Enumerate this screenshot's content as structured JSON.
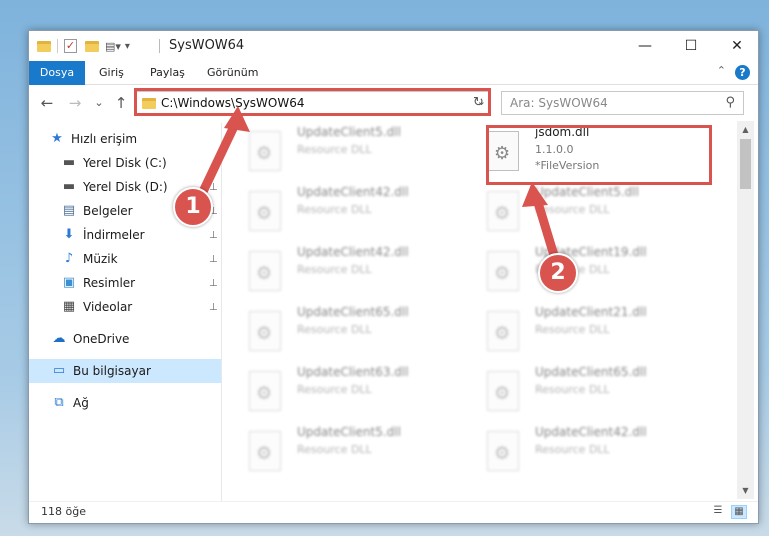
{
  "window": {
    "title": "SysWOW64",
    "minimize_glyph": "—",
    "maximize_glyph": "☐",
    "close_glyph": "✕"
  },
  "ribbon": {
    "tabs": [
      "Dosya",
      "Giriş",
      "Paylaş",
      "Görünüm"
    ],
    "help_glyph": "?",
    "collapse_glyph": "⌃"
  },
  "nav": {
    "back_glyph": "←",
    "forward_glyph": "→",
    "recent_glyph": "⌄",
    "up_glyph": "↑",
    "address": "C:\\Windows\\SysWOW64",
    "address_dropdown_glyph": "⌄",
    "refresh_glyph": "↻",
    "search_placeholder": "Ara: SysWOW64",
    "search_glyph": "⚲"
  },
  "sidebar": {
    "items": [
      {
        "label": "Hızlı erişim",
        "icon": "star-icon",
        "glyph": "★",
        "color": "#2b7bd4"
      },
      {
        "label": "Yerel Disk (C:)",
        "icon": "drive-icon",
        "glyph": "▬",
        "color": "#555555"
      },
      {
        "label": "Yerel Disk (D:)",
        "icon": "drive-icon",
        "glyph": "▬",
        "color": "#555555"
      },
      {
        "label": "Belgeler",
        "icon": "document-icon",
        "glyph": "▤",
        "color": "#4d6f96"
      },
      {
        "label": "İndirmeler",
        "icon": "download-icon",
        "glyph": "⬇",
        "color": "#2b7bd4"
      },
      {
        "label": "Müzik",
        "icon": "music-icon",
        "glyph": "♪",
        "color": "#2b7bd4"
      },
      {
        "label": "Resimler",
        "icon": "pictures-icon",
        "glyph": "▣",
        "color": "#3d8fd1"
      },
      {
        "label": "Videolar",
        "icon": "video-icon",
        "glyph": "▦",
        "color": "#444444"
      },
      {
        "label": "OneDrive",
        "icon": "cloud-icon",
        "glyph": "☁",
        "color": "#1e6fc9"
      },
      {
        "label": "Bu bilgisayar",
        "icon": "computer-icon",
        "glyph": "▭",
        "color": "#2b7bd4"
      },
      {
        "label": "Ağ",
        "icon": "network-icon",
        "glyph": "⧉",
        "color": "#2b7bd4"
      }
    ],
    "pin_glyph": "📌"
  },
  "files": [
    {
      "name": "UpdateClient5.dll",
      "desc": "Resource DLL",
      "blurred": true
    },
    {
      "name": "jsdom.dll",
      "desc": "1.1.0.0",
      "extra": "*FileVersion",
      "blurred": false
    },
    {
      "name": "UpdateClient42.dll",
      "desc": "Resource DLL",
      "blurred": true
    },
    {
      "name": "UpdateClient5.dll",
      "desc": "Resource DLL",
      "blurred": true
    },
    {
      "name": "UpdateClient42.dll",
      "desc": "Resource DLL",
      "blurred": true
    },
    {
      "name": "UpdateClient19.dll",
      "desc": "Resource DLL",
      "blurred": true
    },
    {
      "name": "UpdateClient65.dll",
      "desc": "Resource DLL",
      "blurred": true
    },
    {
      "name": "UpdateClient21.dll",
      "desc": "Resource DLL",
      "blurred": true
    },
    {
      "name": "UpdateClient63.dll",
      "desc": "Resource DLL",
      "blurred": true
    },
    {
      "name": "UpdateClient65.dll",
      "desc": "Resource DLL",
      "blurred": true
    },
    {
      "name": "UpdateClient5.dll",
      "desc": "Resource DLL",
      "blurred": true
    },
    {
      "name": "UpdateClient42.dll",
      "desc": "Resource DLL",
      "blurred": true
    }
  ],
  "scroll": {
    "up_glyph": "▲",
    "down_glyph": "▼"
  },
  "status": {
    "item_count": "118 öğe",
    "details_view_glyph": "☰",
    "tiles_view_glyph": "▦"
  },
  "annotations": {
    "step1": "1",
    "step2": "2",
    "color": "#d9534f"
  }
}
